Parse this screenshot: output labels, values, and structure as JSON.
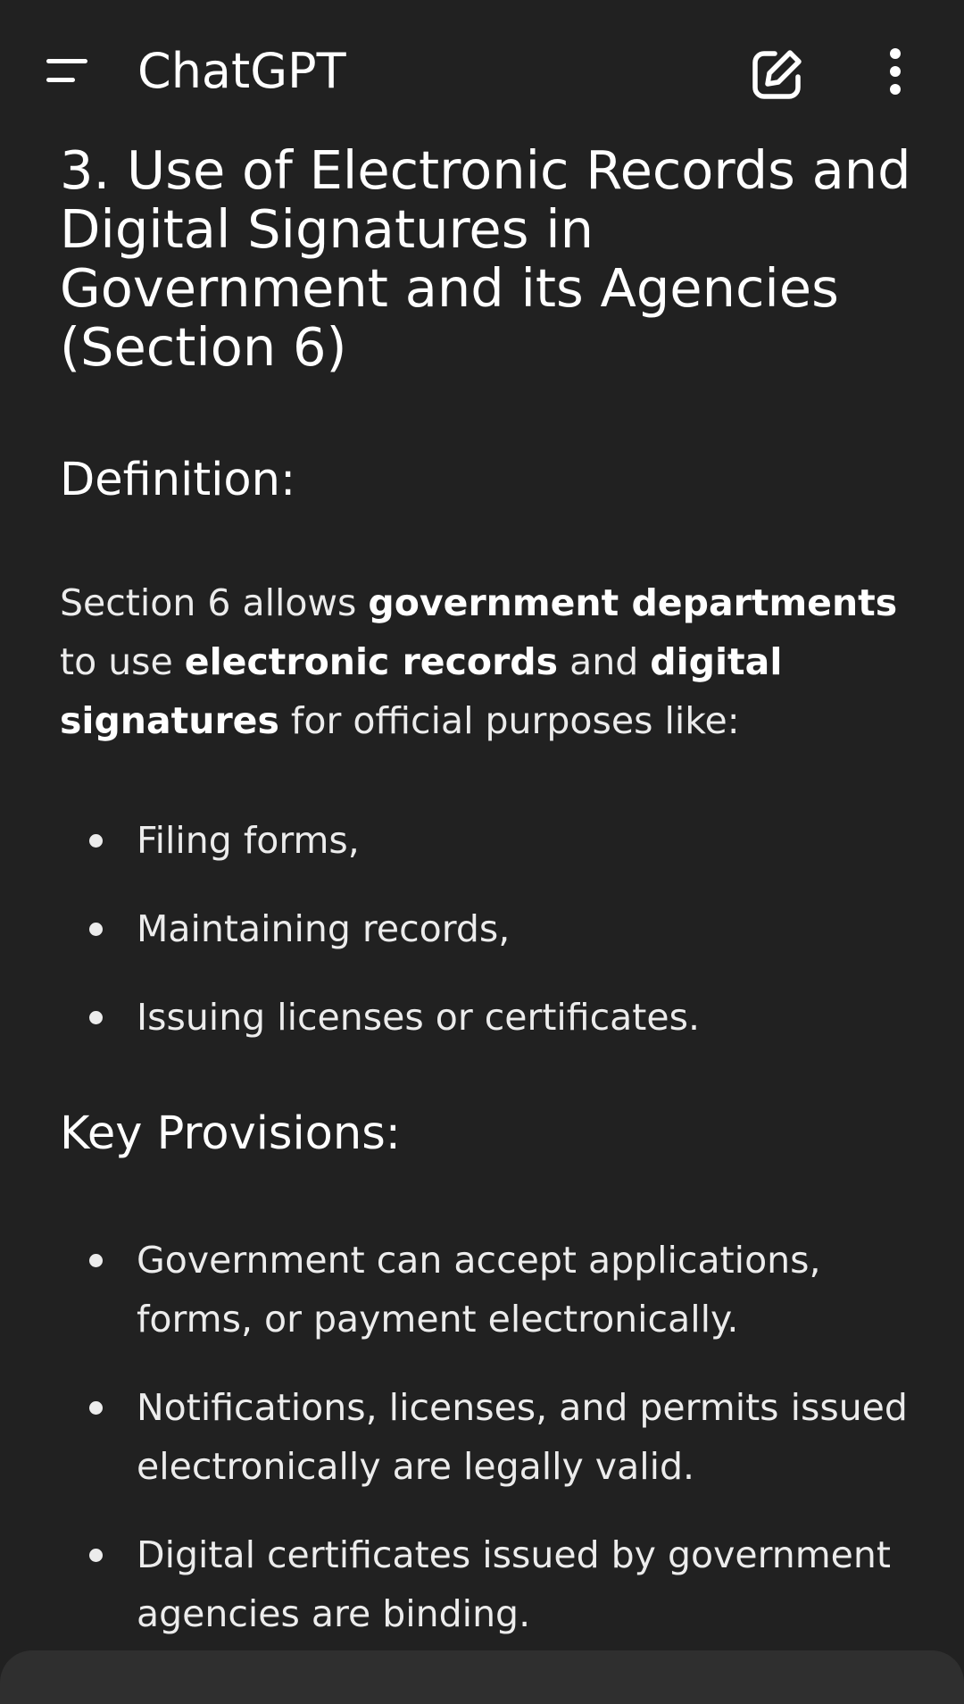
{
  "header": {
    "title": "ChatGPT",
    "menu_icon": "menu-icon",
    "edit_icon": "new-chat-edit-icon",
    "more_icon": "more-vertical-icon"
  },
  "content": {
    "heading": "3. Use of Electronic Records and Digital Signatures in Government and its Agencies (Section 6)",
    "definition_heading": "Definition:",
    "definition_para": {
      "t1": "Section 6 allows ",
      "b1": "government departments",
      "t2": " to use ",
      "b2": "electronic records",
      "t3": " and ",
      "b3": "digital signatures",
      "t4": " for official purposes like:"
    },
    "purposes": [
      "Filing forms,",
      "Maintaining records,",
      "Issuing licenses or certificates."
    ],
    "key_heading": "Key Provisions:",
    "provisions": [
      "Government can accept applications, forms, or payment electronically.",
      "Notifications, licenses, and permits issued electronically are legally valid.",
      "Digital certificates issued by government agencies are binding."
    ]
  },
  "colors": {
    "background": "#212121",
    "text": "#ececec",
    "sheet": "#2f2f2f"
  }
}
